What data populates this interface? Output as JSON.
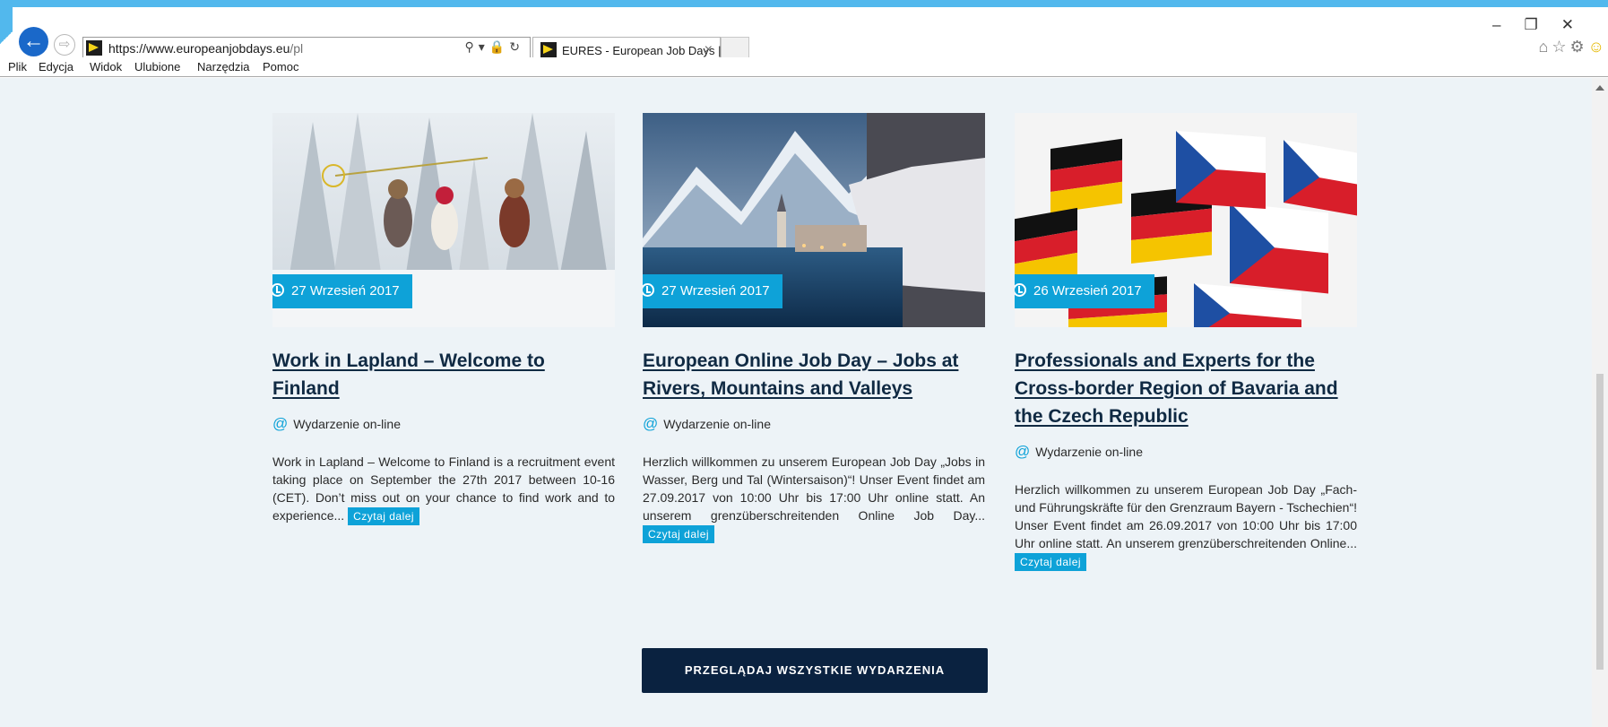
{
  "browser": {
    "url_scheme": "https://www.",
    "url_host": "europeanjobdays.eu",
    "url_path": "/pl",
    "tab_title": "EURES - European Job Days |",
    "menu": [
      "Plik",
      "Edycja",
      "Widok",
      "Ulubione",
      "Narzędzia",
      "Pomoc"
    ],
    "accent_color": "#52b8ed"
  },
  "cards": [
    {
      "date": "27 Wrzesień 2017",
      "title": "Work in Lapland – Welcome to Finland",
      "type": "Wydarzenie on-line",
      "description": "Work in Lapland – Welcome to Finland is a recruitment event taking place on September the 27th 2017 between 10-16 (CET). Don’t miss out on your chance to find work and to experience...",
      "read_more": "Czytaj dalej"
    },
    {
      "date": "27 Wrzesień 2017",
      "title": "European Online Job Day – Jobs at Rivers, Mountains and Valleys",
      "type": "Wydarzenie on-line",
      "description": "Herzlich willkommen zu unserem European Job Day „Jobs in Wasser, Berg und Tal (Wintersaison)“! Unser Event findet am 27.09.2017 von 10:00 Uhr bis 17:00 Uhr online statt. An unserem grenzüberschreitenden Online Job Day...",
      "read_more": "Czytaj dalej"
    },
    {
      "date": "26 Wrzesień 2017",
      "title": "Professionals and Experts for the Cross-border Region of Bavaria and the Czech Republic",
      "type": "Wydarzenie on-line",
      "description": "Herzlich willkommen zu unserem European Job Day „Fach- und Führungskräfte für den Grenzraum Bayern - Tschechien“! Unser Event findet am 26.09.2017 von 10:00 Uhr bis 17:00 Uhr online statt. An unserem grenzüberschreitenden Online...",
      "read_more": "Czytaj dalej"
    }
  ],
  "all_events_button": "PRZEGLĄDAJ WSZYSTKIE WYDARZENIA",
  "colors": {
    "page_bg": "#edf3f7",
    "title": "#102a43",
    "badge": "#0ea2d8",
    "button": "#0a2240"
  }
}
